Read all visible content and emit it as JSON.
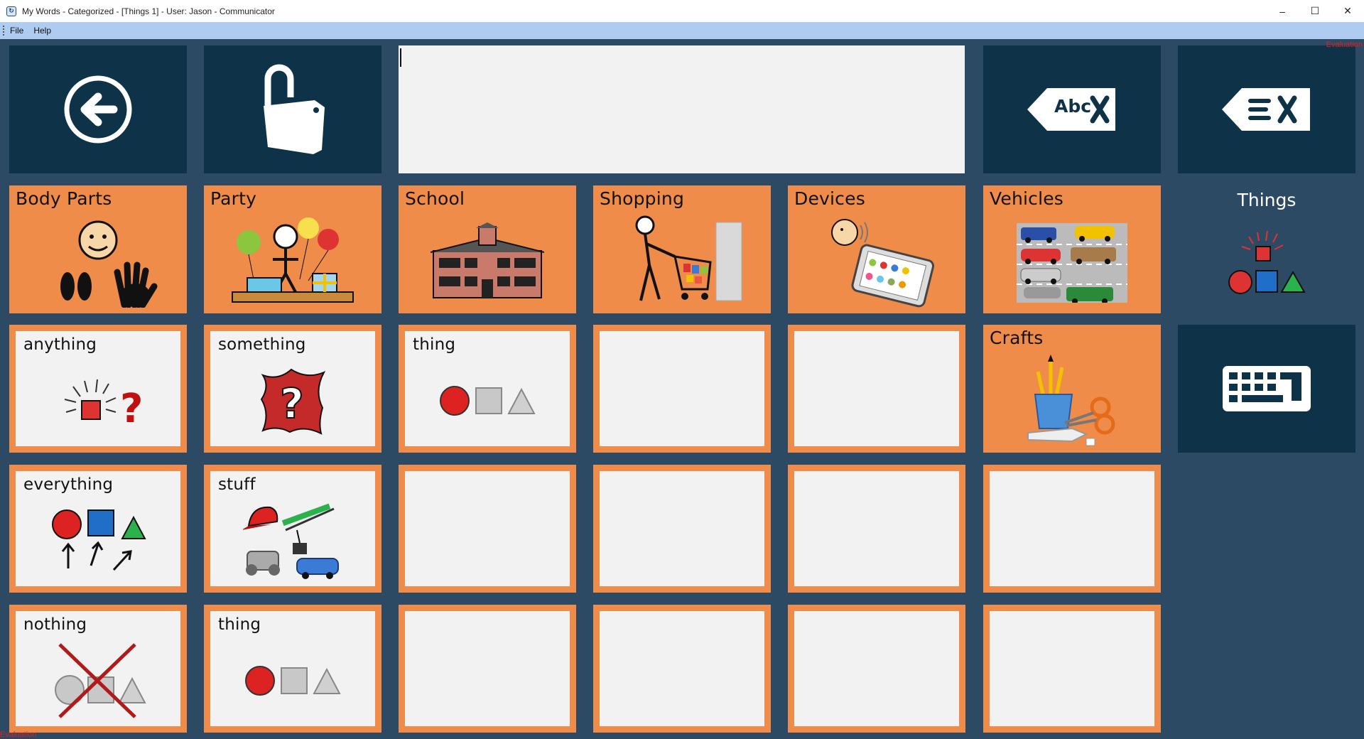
{
  "window": {
    "title": "My Words - Categorized -  [Things 1] - User: Jason - Communicator",
    "controls": [
      "–",
      "☐",
      "✕"
    ]
  },
  "menu": {
    "items": [
      "File",
      "Help"
    ]
  },
  "watermark": "Evaluation",
  "toolbar": {
    "back": "back-arrow",
    "lock": "unlocked-padlock",
    "delete_word_label": "Abc",
    "clear_all": "clear-text"
  },
  "categories": [
    "Body Parts",
    "Party",
    "School",
    "Shopping",
    "Devices",
    "Vehicles",
    "Crafts"
  ],
  "current_page": "Things",
  "words": {
    "anything": "anything",
    "something": "something",
    "thing": "thing",
    "everything": "everything",
    "stuff": "stuff",
    "nothing": "nothing",
    "thing2": "thing"
  },
  "colors": {
    "background": "#2c4a63",
    "dark_tile": "#0e3349",
    "category": "#ef8c4a",
    "word_bg": "#f2f2f2",
    "menu": "#aecbf2"
  }
}
